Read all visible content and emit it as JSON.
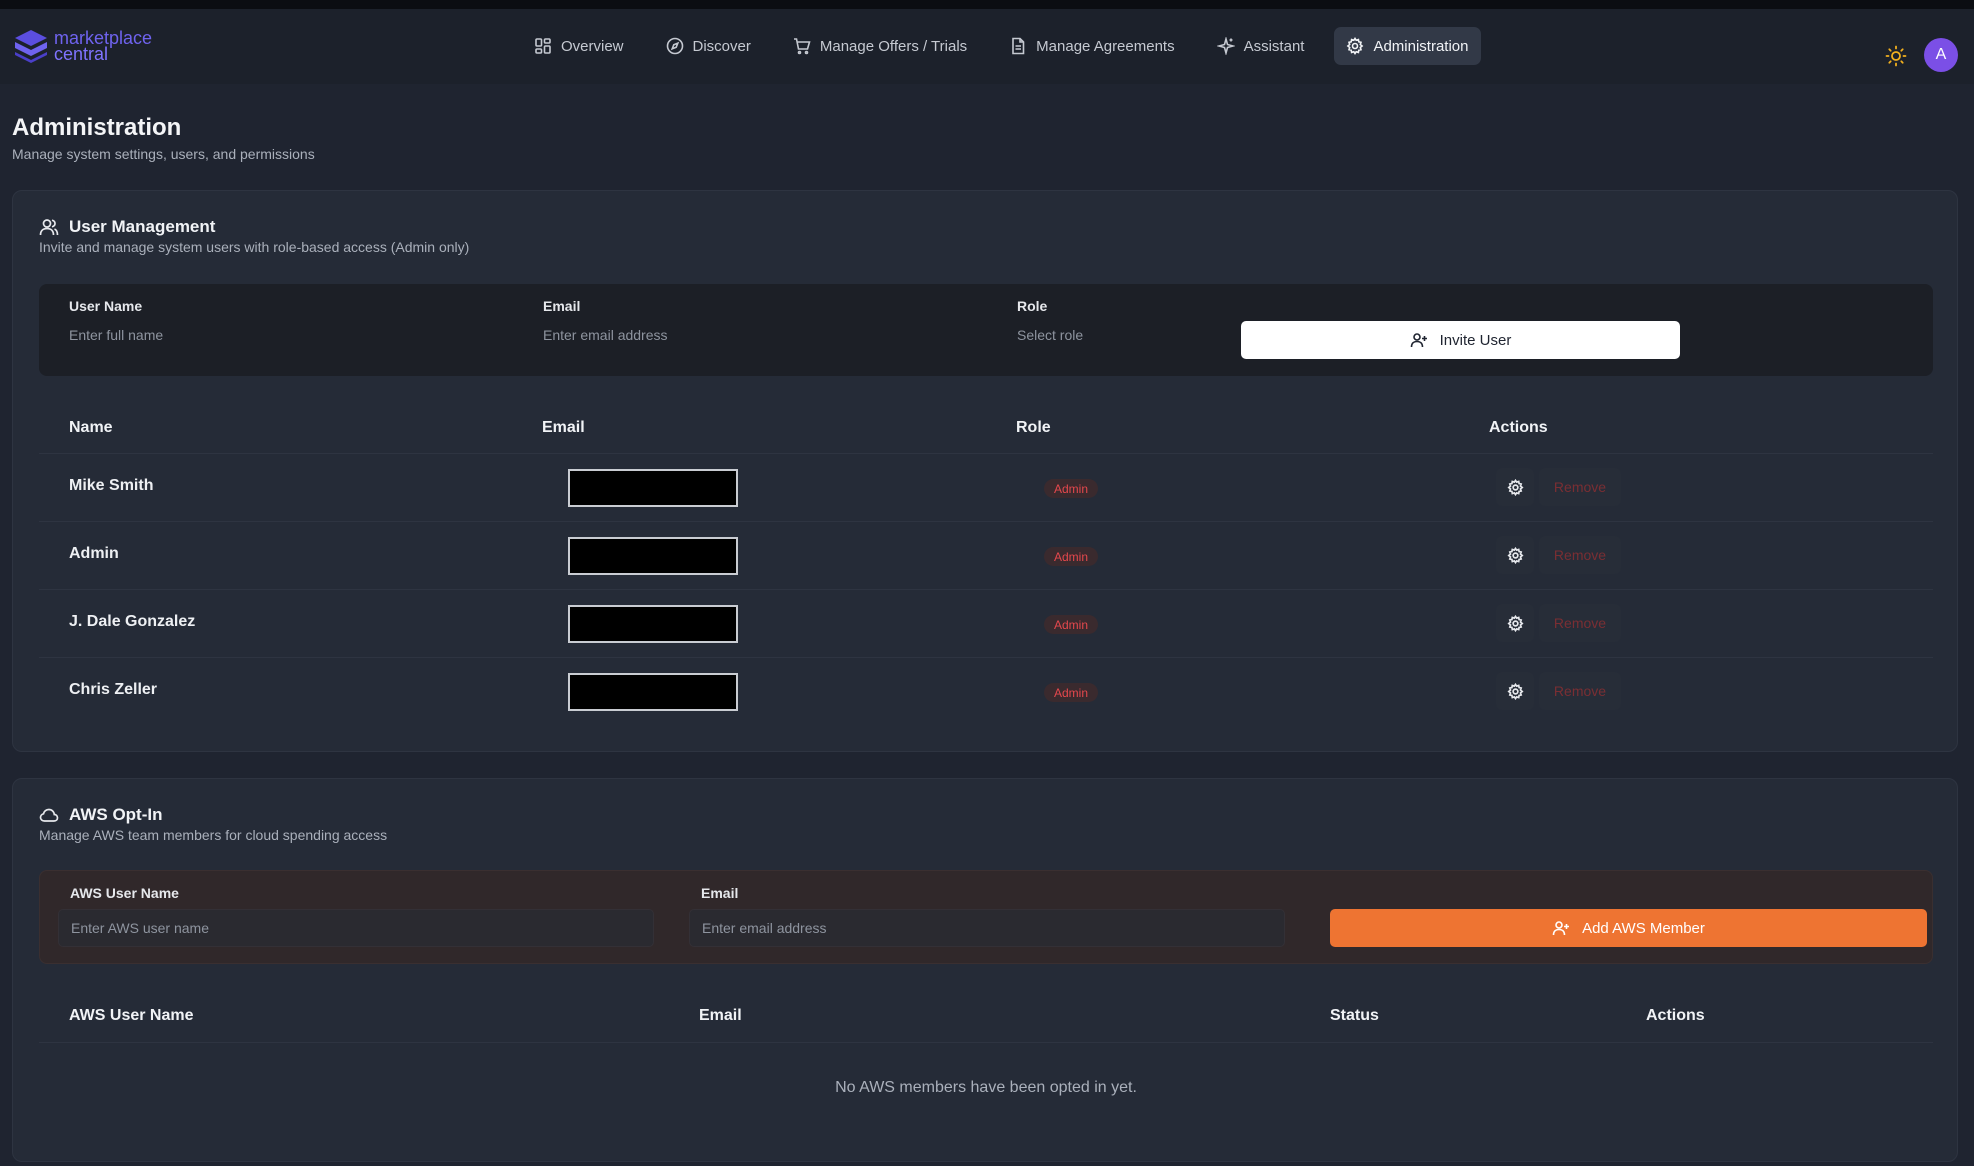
{
  "app": {
    "logo_line1": "marketplace",
    "logo_line2": "central"
  },
  "nav": {
    "items": [
      {
        "label": "Overview",
        "icon": "grid-icon"
      },
      {
        "label": "Discover",
        "icon": "compass-icon"
      },
      {
        "label": "Manage Offers / Trials",
        "icon": "cart-icon"
      },
      {
        "label": "Manage Agreements",
        "icon": "document-icon"
      },
      {
        "label": "Assistant",
        "icon": "sparkle-icon"
      },
      {
        "label": "Administration",
        "icon": "gear-icon",
        "active": true
      }
    ],
    "avatar_initial": "A"
  },
  "page": {
    "title": "Administration",
    "subtitle": "Manage system settings, users, and permissions"
  },
  "user_management": {
    "title": "User Management",
    "description": "Invite and manage system users with role-based access (Admin only)",
    "form": {
      "name_label": "User Name",
      "name_placeholder": "Enter full name",
      "email_label": "Email",
      "email_placeholder": "Enter email address",
      "role_label": "Role",
      "role_placeholder": "Select role",
      "invite_button": "Invite User"
    },
    "table": {
      "headers": [
        "Name",
        "Email",
        "Role",
        "Actions"
      ],
      "rows": [
        {
          "name": "Mike Smith",
          "role": "Admin",
          "remove": "Remove"
        },
        {
          "name": "Admin",
          "role": "Admin",
          "remove": "Remove"
        },
        {
          "name": "J. Dale Gonzalez",
          "role": "Admin",
          "remove": "Remove"
        },
        {
          "name": "Chris Zeller",
          "role": "Admin",
          "remove": "Remove"
        }
      ]
    }
  },
  "aws_opt_in": {
    "title": "AWS Opt-In",
    "description": "Manage AWS team members for cloud spending access",
    "form": {
      "user_label": "AWS User Name",
      "user_placeholder": "Enter AWS user name",
      "email_label": "Email",
      "email_placeholder": "Enter email address",
      "add_button": "Add AWS Member"
    },
    "table": {
      "headers": [
        "AWS User Name",
        "Email",
        "Status",
        "Actions"
      ],
      "empty_message": "No AWS members have been opted in yet."
    }
  },
  "colors": {
    "background": "#1f2430",
    "accent_purple": "#6f63ef",
    "accent_orange": "#ee7432",
    "admin_badge": "#e5484d"
  }
}
